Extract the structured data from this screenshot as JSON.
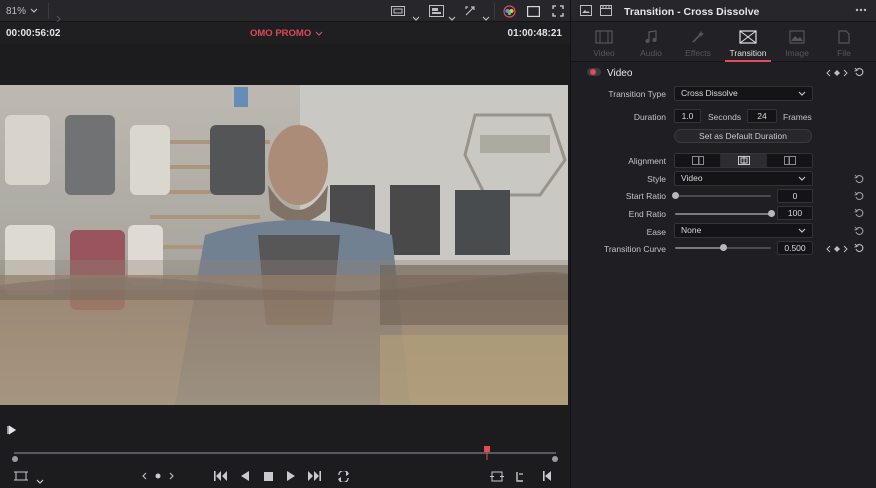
{
  "viewer": {
    "zoom": "81%",
    "timecode_left": "00:00:56:02",
    "project_title": "OMO PROMO",
    "timecode_right": "01:00:48:21",
    "scrubber": {
      "playhead_fraction": 0.873
    }
  },
  "inspector": {
    "title": "Transition - Cross Dissolve",
    "tabs": [
      {
        "label": "Video",
        "icon": "film-icon",
        "active": false
      },
      {
        "label": "Audio",
        "icon": "music-note-icon",
        "active": false
      },
      {
        "label": "Effects",
        "icon": "magic-wand-icon",
        "active": false
      },
      {
        "label": "Transition",
        "icon": "transition-icon",
        "active": true
      },
      {
        "label": "Image",
        "icon": "image-icon",
        "active": false
      },
      {
        "label": "File",
        "icon": "file-icon",
        "active": false
      }
    ],
    "section": {
      "label": "Video",
      "enabled": true
    },
    "fields": {
      "transition_type_label": "Transition Type",
      "transition_type_value": "Cross Dissolve",
      "duration_label": "Duration",
      "duration_seconds": "1.0",
      "seconds_label": "Seconds",
      "duration_frames": "24",
      "frames_label": "Frames",
      "set_default_label": "Set as Default Duration",
      "alignment_label": "Alignment",
      "style_label": "Style",
      "style_value": "Video",
      "start_ratio_label": "Start Ratio",
      "start_ratio_value": "0",
      "end_ratio_label": "End Ratio",
      "end_ratio_value": "100",
      "ease_label": "Ease",
      "ease_value": "None",
      "transition_curve_label": "Transition Curve",
      "transition_curve_value": "0.500"
    },
    "slider_levels": {
      "start_ratio": 0.0,
      "end_ratio": 1.0,
      "transition_curve": 0.5
    }
  },
  "colors": {
    "accent": "#e34b5a",
    "panel_bg": "#1f1f23",
    "toolbar_bg": "#27272b"
  }
}
